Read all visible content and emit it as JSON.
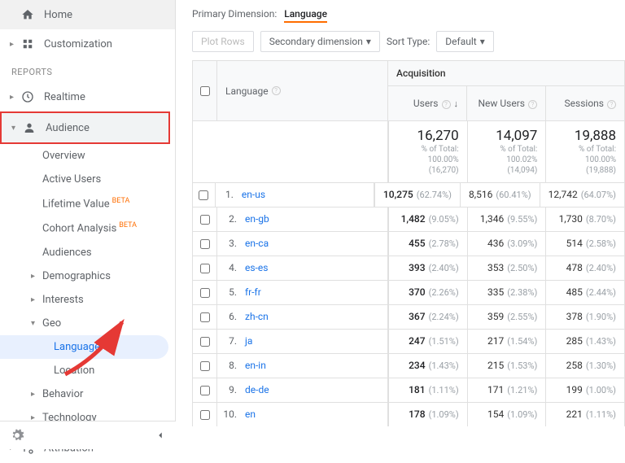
{
  "sidebar": {
    "home": "Home",
    "customization": "Customization",
    "reports_header": "REPORTS",
    "realtime": "Realtime",
    "audience": "Audience",
    "sub": {
      "overview": "Overview",
      "active_users": "Active Users",
      "lifetime_value": "Lifetime Value",
      "cohort": "Cohort Analysis",
      "audiences": "Audiences",
      "demographics": "Demographics",
      "interests": "Interests",
      "geo": "Geo",
      "language": "Language",
      "location": "Location",
      "behavior": "Behavior",
      "technology": "Technology"
    },
    "attribution": "Attribution",
    "beta": "BETA"
  },
  "primary_dimension": {
    "label": "Primary Dimension:",
    "value": "Language"
  },
  "controls": {
    "plot_rows": "Plot Rows",
    "secondary": "Secondary dimension",
    "sort_label": "Sort Type:",
    "sort_value": "Default"
  },
  "table": {
    "header": {
      "language": "Language",
      "acquisition": "Acquisition",
      "users": "Users",
      "new_users": "New Users",
      "sessions": "Sessions"
    },
    "totals": {
      "users": {
        "value": "16,270",
        "sub1": "% of Total: 100.00%",
        "sub2": "(16,270)"
      },
      "new_users": {
        "value": "14,097",
        "sub1": "% of Total:",
        "sub2": "100.02% (14,094)"
      },
      "sessions": {
        "value": "19,888",
        "sub1": "% of Total: 100.00%",
        "sub2": "(19,888)"
      }
    },
    "rows": [
      {
        "idx": "1.",
        "lang": "en-us",
        "users": "10,275",
        "users_pct": "(62.74%)",
        "new": "8,516",
        "new_pct": "(60.41%)",
        "sess": "12,742",
        "sess_pct": "(64.07%)"
      },
      {
        "idx": "2.",
        "lang": "en-gb",
        "users": "1,482",
        "users_pct": "(9.05%)",
        "new": "1,346",
        "new_pct": "(9.55%)",
        "sess": "1,730",
        "sess_pct": "(8.70%)"
      },
      {
        "idx": "3.",
        "lang": "en-ca",
        "users": "455",
        "users_pct": "(2.78%)",
        "new": "436",
        "new_pct": "(3.09%)",
        "sess": "514",
        "sess_pct": "(2.58%)"
      },
      {
        "idx": "4.",
        "lang": "es-es",
        "users": "393",
        "users_pct": "(2.40%)",
        "new": "353",
        "new_pct": "(2.50%)",
        "sess": "478",
        "sess_pct": "(2.40%)"
      },
      {
        "idx": "5.",
        "lang": "fr-fr",
        "users": "370",
        "users_pct": "(2.26%)",
        "new": "335",
        "new_pct": "(2.38%)",
        "sess": "485",
        "sess_pct": "(2.44%)"
      },
      {
        "idx": "6.",
        "lang": "zh-cn",
        "users": "367",
        "users_pct": "(2.24%)",
        "new": "359",
        "new_pct": "(2.55%)",
        "sess": "378",
        "sess_pct": "(1.90%)"
      },
      {
        "idx": "7.",
        "lang": "ja",
        "users": "247",
        "users_pct": "(1.51%)",
        "new": "217",
        "new_pct": "(1.54%)",
        "sess": "285",
        "sess_pct": "(1.43%)"
      },
      {
        "idx": "8.",
        "lang": "en-in",
        "users": "234",
        "users_pct": "(1.43%)",
        "new": "215",
        "new_pct": "(1.53%)",
        "sess": "258",
        "sess_pct": "(1.30%)"
      },
      {
        "idx": "9.",
        "lang": "de-de",
        "users": "181",
        "users_pct": "(1.11%)",
        "new": "171",
        "new_pct": "(1.21%)",
        "sess": "199",
        "sess_pct": "(1.00%)"
      },
      {
        "idx": "10.",
        "lang": "en",
        "users": "178",
        "users_pct": "(1.09%)",
        "new": "154",
        "new_pct": "(1.09%)",
        "sess": "221",
        "sess_pct": "(1.11%)"
      }
    ]
  }
}
